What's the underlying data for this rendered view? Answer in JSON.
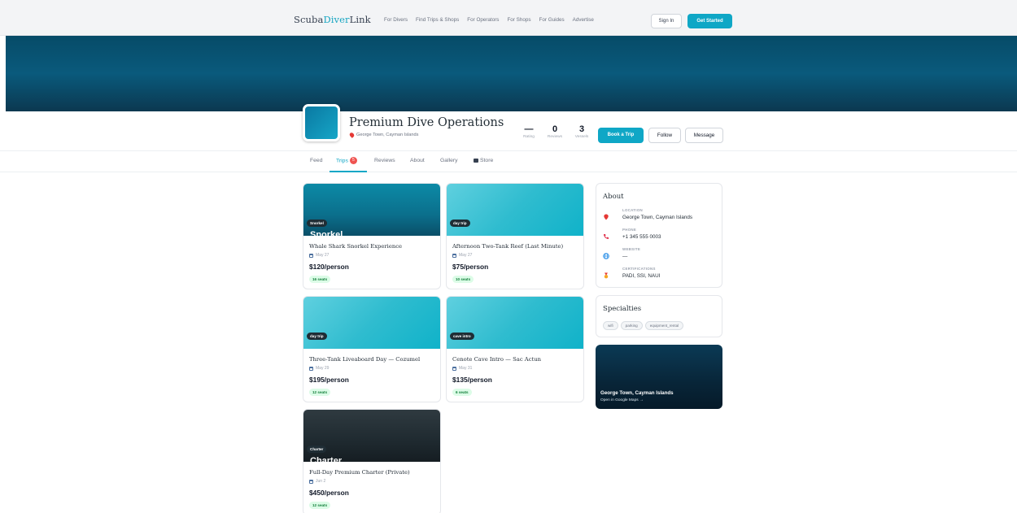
{
  "nav": {
    "logo_part1": "Scuba",
    "logo_part2": "Diver",
    "logo_part3": "Link",
    "links": [
      "For Divers",
      "Find Trips & Shops",
      "For Operators",
      "For Shops",
      "For Guides",
      "Advertise"
    ],
    "sign_in": "Sign In",
    "get_started": "Get Started"
  },
  "profile": {
    "name": "Premium Dive Operations",
    "location": "George Town, Cayman Islands",
    "stats": [
      {
        "value": "—",
        "label": "Rating"
      },
      {
        "value": "0",
        "label": "Reviews"
      },
      {
        "value": "3",
        "label": "Vessels"
      }
    ],
    "book_label": "Book a Trip",
    "follow_label": "Follow",
    "message_label": "Message"
  },
  "tabs": {
    "feed": "Feed",
    "trips": "Trips",
    "trips_count": "5",
    "reviews": "Reviews",
    "about": "About",
    "gallery": "Gallery",
    "store": "Store"
  },
  "trips": [
    {
      "tag": "Snorkel",
      "overlay": "Snorkel",
      "title": "Whale Shark Snorkel Experience",
      "date": "May 27",
      "price": "$120/person",
      "seats": "16 seats"
    },
    {
      "tag": "day trip",
      "overlay": "",
      "title": "Afternoon Two-Tank Reef (Last Minute)",
      "date": "May 27",
      "price": "$75/person",
      "seats": "10 seats"
    },
    {
      "tag": "day trip",
      "overlay": "",
      "title": "Three-Tank Liveaboard Day — Cozumel",
      "date": "May 29",
      "price": "$195/person",
      "seats": "12 seats"
    },
    {
      "tag": "cave intro",
      "overlay": "",
      "title": "Cenote Cave Intro — Sac Actun",
      "date": "May 31",
      "price": "$135/person",
      "seats": "6 seats"
    },
    {
      "tag": "Charter",
      "overlay": "Charter",
      "title": "Full-Day Premium Charter (Private)",
      "date": "Jun 2",
      "price": "$450/person",
      "seats": "12 seats"
    }
  ],
  "about": {
    "heading": "About",
    "location_label": "LOCATION",
    "location_value": "George Town, Cayman Islands",
    "phone_label": "PHONE",
    "phone_value": "+1 345 555 0003",
    "website_label": "WEBSITE",
    "website_value": "—",
    "cert_label": "CERTIFICATIONS",
    "cert_value": "PADI, SSI, NAUI"
  },
  "specialties": {
    "heading": "Specialties",
    "items": [
      "wifi",
      "parking",
      "equipment_rental"
    ]
  },
  "map": {
    "city": "George Town, Cayman Islands",
    "open_link": "Open in Google Maps →"
  },
  "colors": {
    "accent": "#0fa7c6",
    "badge_red": "#ef5350",
    "seats_bg": "#dcfce7",
    "seats_text": "#15803d"
  }
}
